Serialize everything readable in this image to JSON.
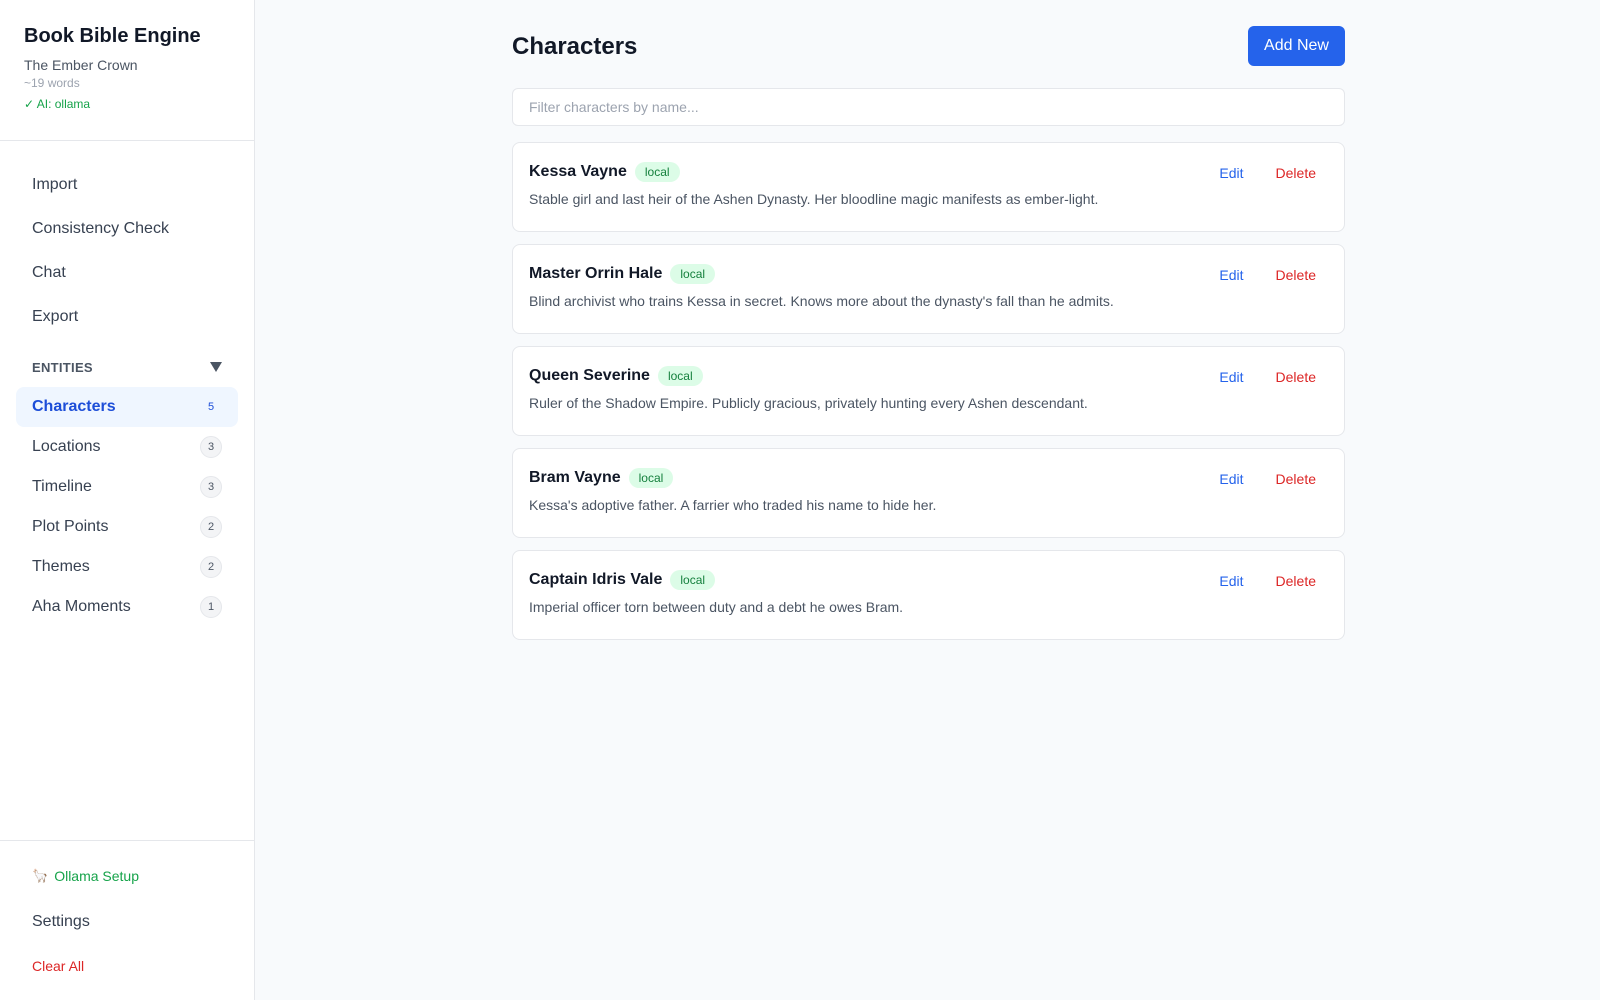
{
  "app": {
    "title": "Book Bible Engine",
    "book": "The Ember Crown",
    "words": "~19 words",
    "ai_status": "✓ AI: ollama"
  },
  "nav": [
    {
      "label": "Import"
    },
    {
      "label": "Consistency Check"
    },
    {
      "label": "Chat"
    },
    {
      "label": "Export"
    }
  ],
  "entities": {
    "heading": "ENTITIES",
    "items": [
      {
        "label": "Characters",
        "count": "5"
      },
      {
        "label": "Locations",
        "count": "3"
      },
      {
        "label": "Timeline",
        "count": "3"
      },
      {
        "label": "Plot Points",
        "count": "2"
      },
      {
        "label": "Themes",
        "count": "2"
      },
      {
        "label": "Aha Moments",
        "count": "1"
      }
    ]
  },
  "footer": {
    "ollama_icon": "🦙",
    "ollama": "Ollama Setup",
    "settings": "Settings",
    "clear": "Clear All"
  },
  "main": {
    "title": "Characters",
    "add_label": "Add New",
    "filter_placeholder": "Filter characters by name...",
    "edit_label": "Edit",
    "delete_label": "Delete",
    "characters": [
      {
        "name": "Kessa Vayne",
        "tag": "local",
        "desc": "Stable girl and last heir of the Ashen Dynasty. Her bloodline magic manifests as ember-light."
      },
      {
        "name": "Master Orrin Hale",
        "tag": "local",
        "desc": "Blind archivist who trains Kessa in secret. Knows more about the dynasty's fall than he admits."
      },
      {
        "name": "Queen Severine",
        "tag": "local",
        "desc": "Ruler of the Shadow Empire. Publicly gracious, privately hunting every Ashen descendant."
      },
      {
        "name": "Bram Vayne",
        "tag": "local",
        "desc": "Kessa's adoptive father. A farrier who traded his name to hide her."
      },
      {
        "name": "Captain Idris Vale",
        "tag": "local",
        "desc": "Imperial officer torn between duty and a debt he owes Bram."
      }
    ]
  },
  "colors": {
    "accent": "#2563eb",
    "danger": "#dc2626",
    "success": "#16a34a",
    "tag_bg": "#dcfce7"
  }
}
